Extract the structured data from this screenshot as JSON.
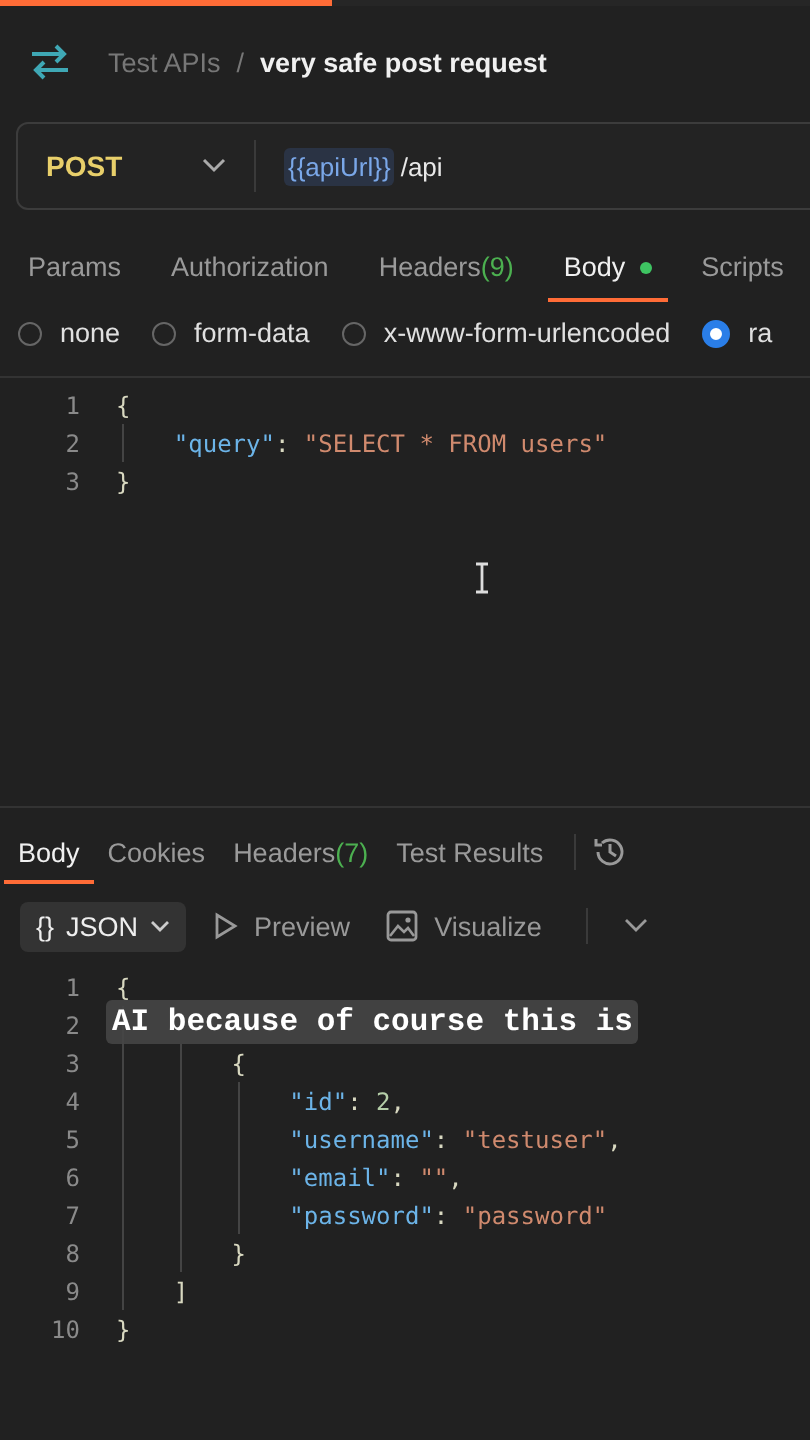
{
  "loading_bar": {
    "level": 0.41
  },
  "breadcrumb": {
    "collection": "Test APIs",
    "separator": "/",
    "request": "very safe post request"
  },
  "url_bar": {
    "method": "POST",
    "variable": "{{apiUrl}}",
    "path": "/api"
  },
  "request_tabs": [
    {
      "label": "Params",
      "selected": false
    },
    {
      "label": "Authorization",
      "selected": false
    },
    {
      "label": "Headers",
      "count": "(9)",
      "selected": false
    },
    {
      "label": "Body",
      "dot": true,
      "selected": true
    },
    {
      "label": "Scripts",
      "selected": false
    }
  ],
  "body_types": [
    {
      "label": "none",
      "selected": false
    },
    {
      "label": "form-data",
      "selected": false
    },
    {
      "label": "x-www-form-urlencoded",
      "selected": false
    },
    {
      "label": "ra",
      "selected": true
    }
  ],
  "request_body": [
    {
      "number": "1",
      "tokens": [
        {
          "kind": "punct",
          "text": "{"
        }
      ],
      "children": [
        {
          "number": "2",
          "tokens": [
            {
              "kind": "key",
              "text": "\"query\""
            },
            {
              "kind": "punct",
              "text": ": "
            },
            {
              "kind": "string",
              "text": "\"SELECT * FROM users\""
            }
          ]
        }
      ]
    },
    {
      "number": "3",
      "tokens": [
        {
          "kind": "punct",
          "text": "}"
        }
      ]
    }
  ],
  "response_tabs": [
    {
      "label": "Body",
      "selected": true
    },
    {
      "label": "Cookies",
      "selected": false
    },
    {
      "label": "Headers",
      "count": "(7)",
      "selected": false
    },
    {
      "label": "Test Results",
      "selected": false
    }
  ],
  "response_toolbar": {
    "format": "JSON",
    "format_icon": "{}",
    "preview": "Preview",
    "visualize": "Visualize"
  },
  "response_body": [
    {
      "number": "1",
      "tokens": [
        {
          "kind": "punct",
          "text": "{"
        }
      ],
      "children": [
        {
          "number": "2",
          "children": [
            {
              "number": "3",
              "tokens": [
                {
                  "kind": "punct",
                  "text": "{"
                }
              ],
              "children": [
                {
                  "number": "4",
                  "tokens": [
                    {
                      "kind": "key",
                      "text": "\"id\""
                    },
                    {
                      "kind": "punct",
                      "text": ": "
                    },
                    {
                      "kind": "number",
                      "text": "2"
                    },
                    {
                      "kind": "punct",
                      "text": ","
                    }
                  ]
                },
                {
                  "number": "5",
                  "tokens": [
                    {
                      "kind": "key",
                      "text": "\"username\""
                    },
                    {
                      "kind": "punct",
                      "text": ": "
                    },
                    {
                      "kind": "string",
                      "text": "\"testuser\""
                    },
                    {
                      "kind": "punct",
                      "text": ","
                    }
                  ]
                },
                {
                  "number": "6",
                  "tokens": [
                    {
                      "kind": "key",
                      "text": "\"email\""
                    },
                    {
                      "kind": "punct",
                      "text": ": "
                    },
                    {
                      "kind": "string",
                      "text": "\"\""
                    },
                    {
                      "kind": "punct",
                      "text": ","
                    }
                  ]
                },
                {
                  "number": "7",
                  "tokens": [
                    {
                      "kind": "key",
                      "text": "\"password\""
                    },
                    {
                      "kind": "punct",
                      "text": ": "
                    },
                    {
                      "kind": "string",
                      "text": "\"password\""
                    }
                  ]
                }
              ]
            },
            {
              "number": "8",
              "tokens": [
                {
                  "kind": "punct",
                  "text": "}"
                }
              ]
            }
          ]
        },
        {
          "number": "9",
          "tokens": [
            {
              "kind": "punct",
              "text": "]"
            }
          ]
        }
      ]
    },
    {
      "number": "10",
      "tokens": [
        {
          "kind": "punct",
          "text": "}"
        }
      ]
    }
  ],
  "caption": "AI because of course this is"
}
